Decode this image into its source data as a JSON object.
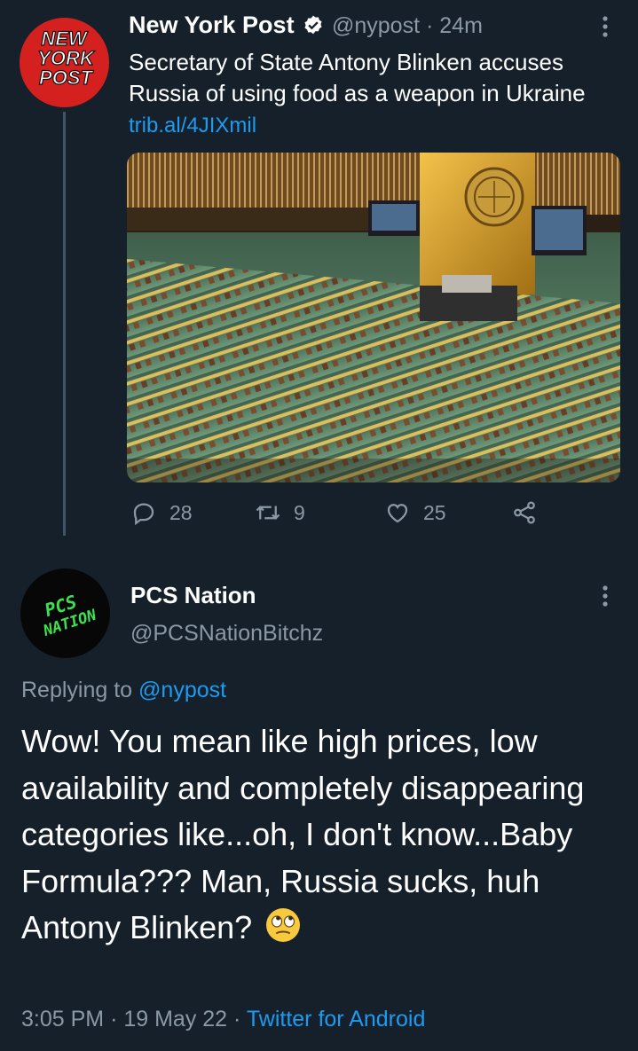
{
  "tweet1": {
    "avatar_text": [
      "NEW",
      "YORK",
      "POST"
    ],
    "display_name": "New York Post",
    "handle": "@nypost",
    "separator": "·",
    "time": "24m",
    "text": "Secretary of State Antony Blinken accuses Russia of using food as a weapon in Ukraine",
    "link": "trib.al/4JIXmil",
    "media": {
      "icon": "un-assembly-photo"
    },
    "stats": {
      "replies": "28",
      "retweets": "9",
      "likes": "25"
    }
  },
  "tweet2": {
    "avatar_text": [
      "PCS",
      "NATION"
    ],
    "display_name": "PCS Nation",
    "handle": "@PCSNationBitchz",
    "replying_prefix": "Replying to",
    "replying_to": "@nypost",
    "text": "Wow! You mean like high prices, low availability and completely disappearing categories like...oh, I don't know...Baby Formula??? Man, Russia sucks, huh Antony Blinken?",
    "emoji": "face-with-rolling-eyes",
    "time": "3:05 PM",
    "separator": "·",
    "date": "19 May 22",
    "source": "Twitter for Android"
  },
  "colors": {
    "background": "#15202b",
    "text": "#ffffff",
    "secondary": "#8b98a5",
    "link": "#1d9bf0",
    "nyp_red": "#d52020",
    "pcs_green": "#3ee24f"
  }
}
